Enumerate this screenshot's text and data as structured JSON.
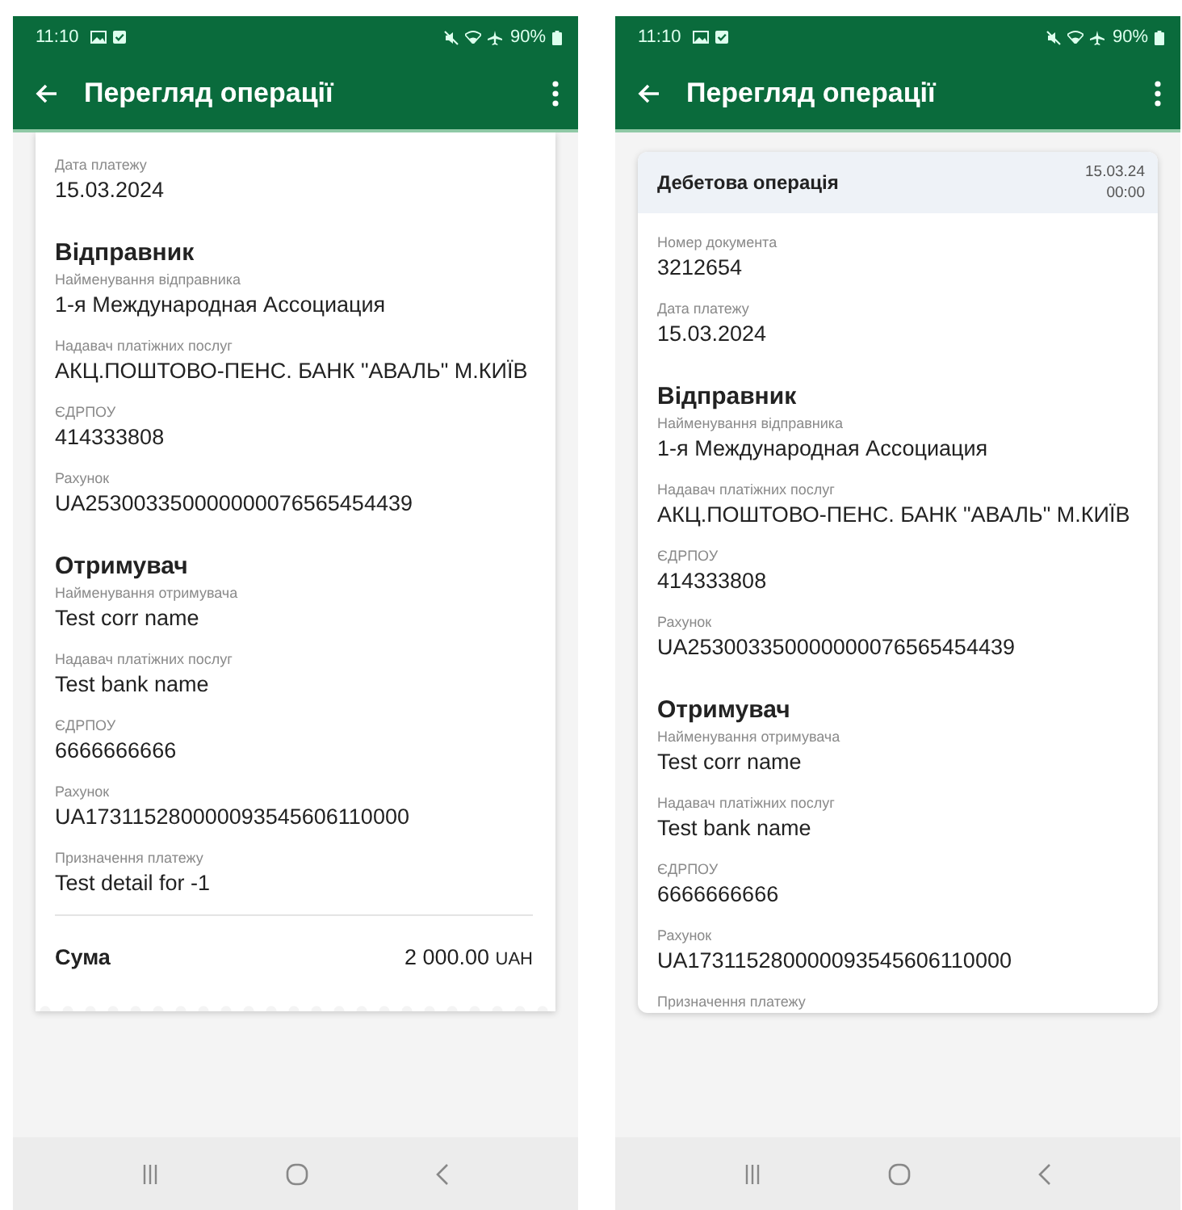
{
  "screens": [
    {
      "status_bar": {
        "time": "11:10",
        "battery": "90%"
      },
      "app_bar": {
        "title": "Перегляд операції"
      },
      "blocks": [
        {
          "kind": "field",
          "label": "Дата платежу",
          "value": "15.03.2024"
        },
        {
          "kind": "section",
          "title": "Відправник"
        },
        {
          "kind": "field",
          "label": "Найменування відправника",
          "value": "1-я Международная Ассоциация"
        },
        {
          "kind": "field",
          "label": "Надавач платіжних послуг",
          "value": "АКЦ.ПОШТОВО-ПЕНС. БАНК \"АВАЛЬ\" М.КИЇВ"
        },
        {
          "kind": "field",
          "label": "ЄДРПОУ",
          "value": "414333808"
        },
        {
          "kind": "field",
          "label": "Рахунок",
          "value": "UA253003350000000076565454439"
        },
        {
          "kind": "section",
          "title": "Отримувач"
        },
        {
          "kind": "field",
          "label": "Найменування отримувача",
          "value": "Test corr name"
        },
        {
          "kind": "field",
          "label": "Надавач платіжних послуг",
          "value": "Test bank name"
        },
        {
          "kind": "field",
          "label": "ЄДРПОУ",
          "value": "6666666666"
        },
        {
          "kind": "field",
          "label": "Рахунок",
          "value": "UA173115280000093545606110000"
        },
        {
          "kind": "field",
          "label": "Призначення платежу",
          "value": "Test detail for -1"
        },
        {
          "kind": "total",
          "label": "Сума",
          "amount": "2 000.00",
          "currency": "UAH"
        }
      ]
    },
    {
      "status_bar": {
        "time": "11:10",
        "battery": "90%"
      },
      "app_bar": {
        "title": "Перегляд операції"
      },
      "header": {
        "title": "Дебетова операція",
        "date": "15.03.24",
        "time": "00:00"
      },
      "blocks": [
        {
          "kind": "field",
          "label": "Номер документа",
          "value": "3212654"
        },
        {
          "kind": "field",
          "label": "Дата платежу",
          "value": "15.03.2024"
        },
        {
          "kind": "section",
          "title": "Відправник"
        },
        {
          "kind": "field",
          "label": "Найменування відправника",
          "value": "1-я Международная Ассоциация"
        },
        {
          "kind": "field",
          "label": "Надавач платіжних послуг",
          "value": "АКЦ.ПОШТОВО-ПЕНС. БАНК \"АВАЛЬ\" М.КИЇВ"
        },
        {
          "kind": "field",
          "label": "ЄДРПОУ",
          "value": "414333808"
        },
        {
          "kind": "field",
          "label": "Рахунок",
          "value": "UA253003350000000076565454439"
        },
        {
          "kind": "section",
          "title": "Отримувач"
        },
        {
          "kind": "field",
          "label": "Найменування отримувача",
          "value": "Test corr name"
        },
        {
          "kind": "field",
          "label": "Надавач платіжних послуг",
          "value": "Test bank name"
        },
        {
          "kind": "field",
          "label": "ЄДРПОУ",
          "value": "6666666666"
        },
        {
          "kind": "field",
          "label": "Рахунок",
          "value": "UA173115280000093545606110000"
        },
        {
          "kind": "field",
          "label": "Призначення платежу"
        }
      ]
    }
  ]
}
